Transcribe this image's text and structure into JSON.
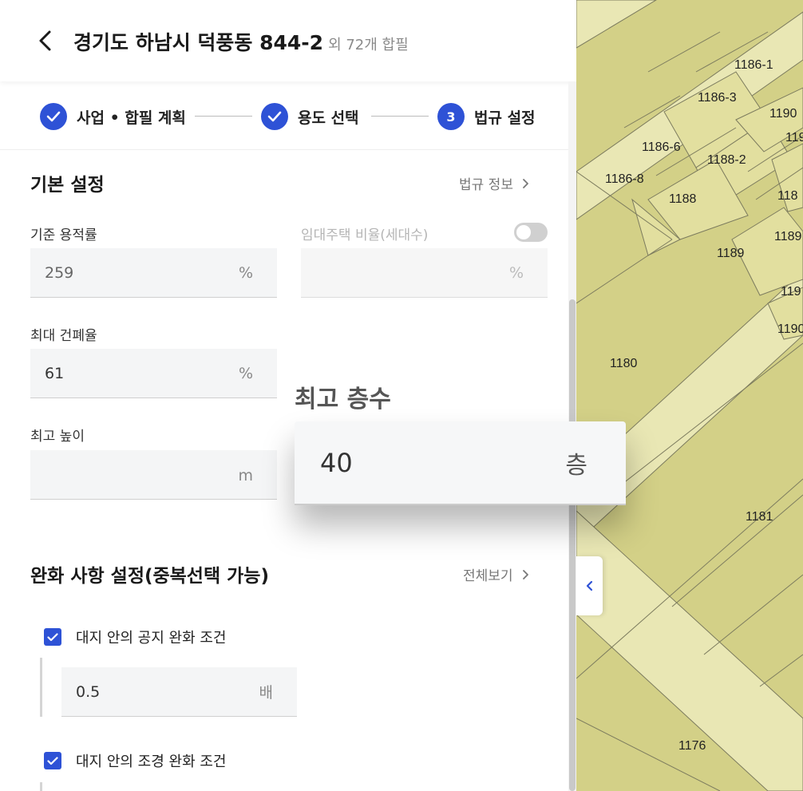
{
  "header": {
    "title": "경기도 하남시 덕풍동 844-2",
    "subtitle": "외 72개 합필"
  },
  "stepper": {
    "steps": [
      {
        "label": "사업 • 합필 계획",
        "status": "done"
      },
      {
        "label": "용도 선택",
        "status": "done"
      },
      {
        "number": "3",
        "label": "법규 설정",
        "status": "current"
      }
    ]
  },
  "basic": {
    "title": "기본 설정",
    "link": "법규 정보",
    "far": {
      "label": "기준 용적률",
      "value": "259",
      "unit": "%"
    },
    "rental": {
      "label": "임대주택 비율(세대수)",
      "value": "",
      "unit": "%",
      "enabled": false
    },
    "bcr": {
      "label": "최대 건폐율",
      "value": "61",
      "unit": "%"
    },
    "height": {
      "label": "최고 높이",
      "value": "",
      "unit": "m"
    }
  },
  "zoom": {
    "label": "최고 층수",
    "value": "40",
    "unit": "층"
  },
  "relax": {
    "title": "완화 사항 설정(중복선택 가능)",
    "link": "전체보기",
    "items": [
      {
        "label": "대지 안의 공지 완화 조건",
        "checked": true,
        "value": "0.5",
        "unit": "배"
      },
      {
        "label": "대지 안의 조경 완화 조건",
        "checked": true
      }
    ]
  },
  "map": {
    "lots": [
      "1186-1",
      "1186-3",
      "1190",
      "119",
      "1186-6",
      "1188-2",
      "1186-8",
      "1188",
      "118",
      "1189",
      "1189",
      "119",
      "1190",
      "1180",
      "1181",
      "1176"
    ]
  },
  "colors": {
    "accent": "#2e52d6",
    "map_fill": "#d3d087",
    "map_road": "#e9e7b4"
  }
}
